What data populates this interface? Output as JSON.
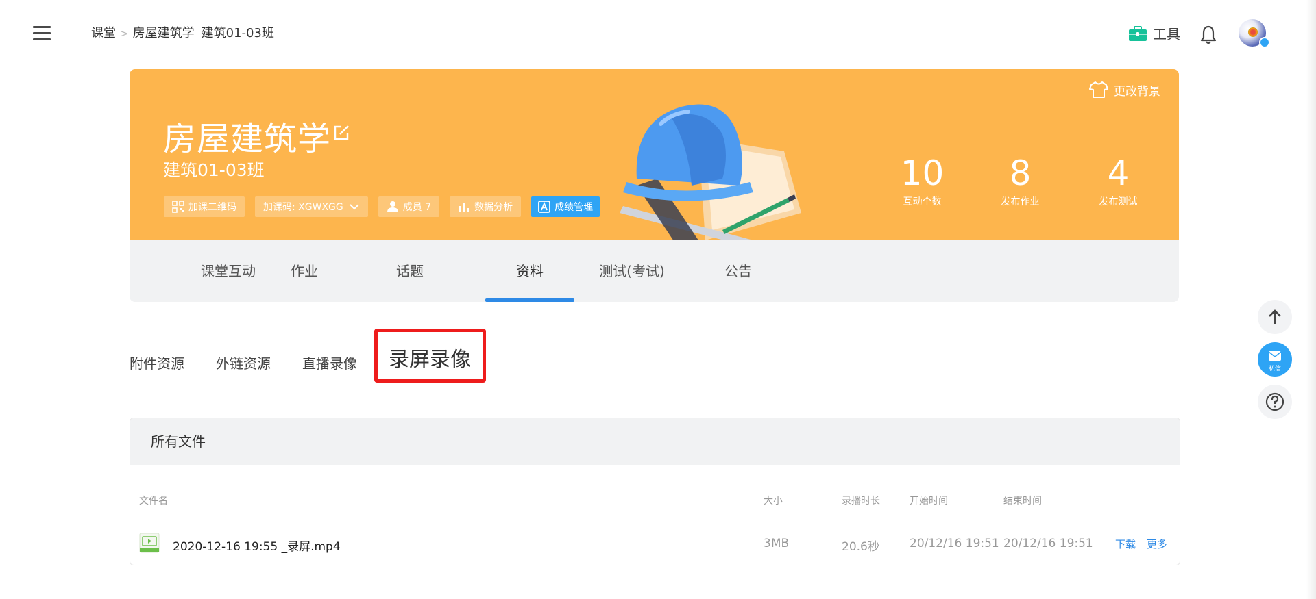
{
  "breadcrumb": {
    "root": "课堂",
    "separator": ">",
    "course": "房屋建筑学",
    "class": "建筑01-03班"
  },
  "header": {
    "tools_label": "工具"
  },
  "banner": {
    "title": "房屋建筑学",
    "class_name": "建筑01-03班",
    "change_bg_label": "更改背景",
    "chips": {
      "qr": "加课二维码",
      "code": "加课码: XGWXGG",
      "members": "成员 7",
      "analysis": "数据分析",
      "grades": "成绩管理"
    },
    "stats": [
      {
        "value": "10",
        "label": "互动个数"
      },
      {
        "value": "8",
        "label": "发布作业"
      },
      {
        "value": "4",
        "label": "发布测试"
      }
    ],
    "colors": {
      "background": "#fdb54d",
      "accent": "#2ea4f5"
    }
  },
  "main_tabs": [
    {
      "label": "课堂互动"
    },
    {
      "label": "作业"
    },
    {
      "label": "话题"
    },
    {
      "label": "资料",
      "active": true
    },
    {
      "label": "测试(考试)"
    },
    {
      "label": "公告"
    }
  ],
  "sub_tabs": [
    {
      "label": "附件资源"
    },
    {
      "label": "外链资源"
    },
    {
      "label": "直播录像"
    },
    {
      "label": "录屏录像",
      "active": true
    }
  ],
  "files": {
    "panel_title": "所有文件",
    "columns": {
      "name": "文件名",
      "size": "大小",
      "duration": "录播时长",
      "start": "开始时间",
      "end": "结束时间"
    },
    "rows": [
      {
        "name": "2020-12-16 19:55 _录屏.mp4",
        "size": "3MB",
        "duration": "20.6秒",
        "start": "20/12/16 19:51",
        "end": "20/12/16 19:51",
        "actions": {
          "download": "下载",
          "more": "更多"
        }
      }
    ]
  },
  "floating": {
    "mail_label": "私信"
  }
}
